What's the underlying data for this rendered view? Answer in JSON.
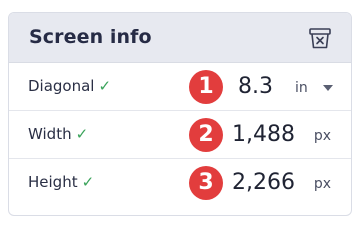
{
  "panel": {
    "title": "Screen info",
    "clear_icon": "trash-x-icon"
  },
  "rows": [
    {
      "label": "Diagonal",
      "check": "✓",
      "badge": "1",
      "value": "8.3",
      "unit": "in",
      "unit_selectable": true
    },
    {
      "label": "Width",
      "check": "✓",
      "badge": "2",
      "value": "1,488",
      "unit": "px",
      "unit_selectable": false
    },
    {
      "label": "Height",
      "check": "✓",
      "badge": "3",
      "value": "2,266",
      "unit": "px",
      "unit_selectable": false
    }
  ],
  "colors": {
    "header_bg": "#e7e9f0",
    "badge": "#e23d3d",
    "check": "#3aa35a",
    "text": "#262b45"
  }
}
